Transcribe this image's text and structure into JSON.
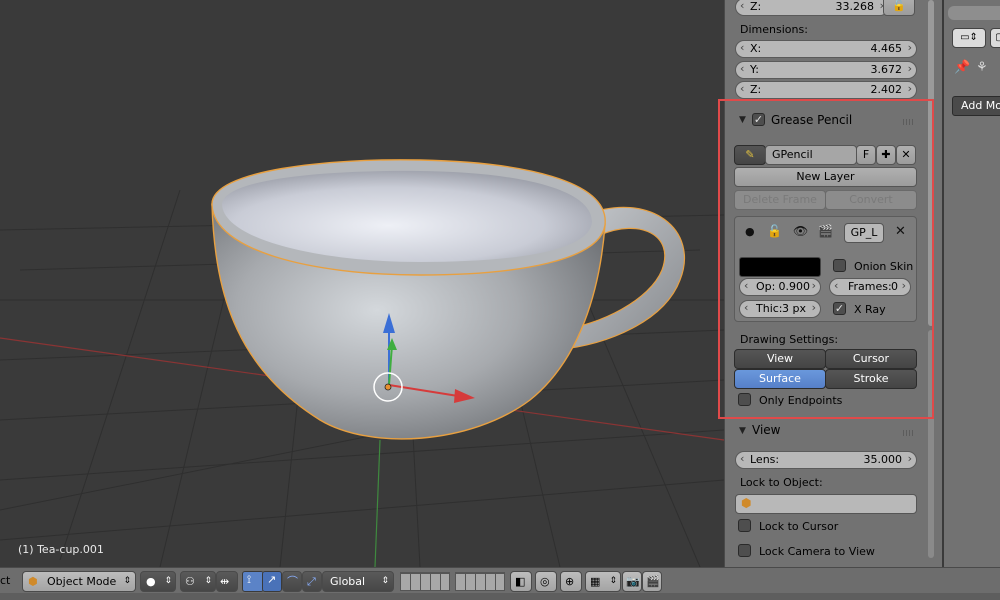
{
  "viewport": {
    "object_label": "(1) Tea-cup.001"
  },
  "transform": {
    "loc_z_label": "Z:",
    "loc_z_value": "33.268",
    "dimensions_label": "Dimensions:",
    "dim_x_label": "X:",
    "dim_x_value": "4.465",
    "dim_y_label": "Y:",
    "dim_y_value": "3.672",
    "dim_z_label": "Z:",
    "dim_z_value": "2.402"
  },
  "grease_pencil": {
    "title": "Grease Pencil",
    "datablock_name": "GPencil",
    "fake_user": "F",
    "new_layer": "New Layer",
    "delete_frame": "Delete Frame",
    "convert": "Convert",
    "layer_name": "GP_L",
    "opacity_label": "Op:",
    "opacity_value": "0.900",
    "thickness_label": "Thic:",
    "thickness_value": "3 px",
    "onion_skin": "Onion Skin",
    "frames_label": "Frames:",
    "frames_value": "0",
    "xray": "X Ray",
    "drawing_settings_label": "Drawing Settings:",
    "draw_view": "View",
    "draw_cursor": "Cursor",
    "draw_surface": "Surface",
    "draw_stroke": "Stroke",
    "only_endpoints": "Only Endpoints",
    "color_swatch": "#000000"
  },
  "view_panel": {
    "title": "View",
    "lens_label": "Lens:",
    "lens_value": "35.000",
    "lock_to_object": "Lock to Object:",
    "lock_to_cursor": "Lock to Cursor",
    "lock_camera": "Lock Camera to View"
  },
  "sliver": {
    "add_modifier": "Add Mod"
  },
  "toolbar": {
    "edge_text": "ct",
    "mode": "Object Mode",
    "orientation": "Global"
  },
  "colors": {
    "highlight_box": "#e04a4a",
    "active_button": "#5a84cc",
    "selection_outline": "#e8a040"
  }
}
